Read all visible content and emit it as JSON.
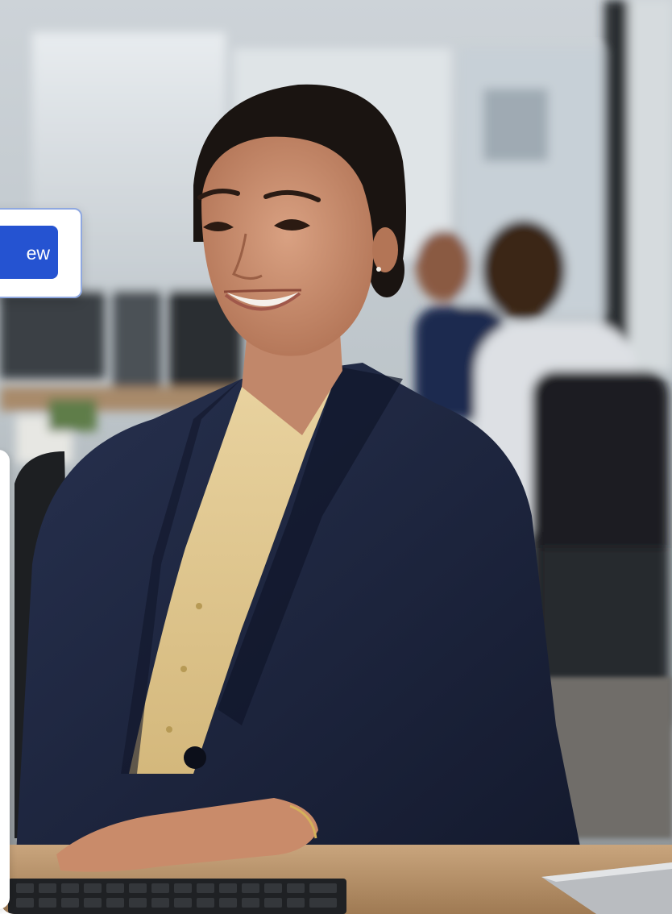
{
  "hero": {
    "image_subject": "professional-woman-at-desk"
  },
  "review_card": {
    "button_label": "ew"
  },
  "colors": {
    "accent": "#2553d1",
    "card_border": "#8fa8e0",
    "blazer": "#1c2540",
    "blouse": "#e2c98e"
  }
}
